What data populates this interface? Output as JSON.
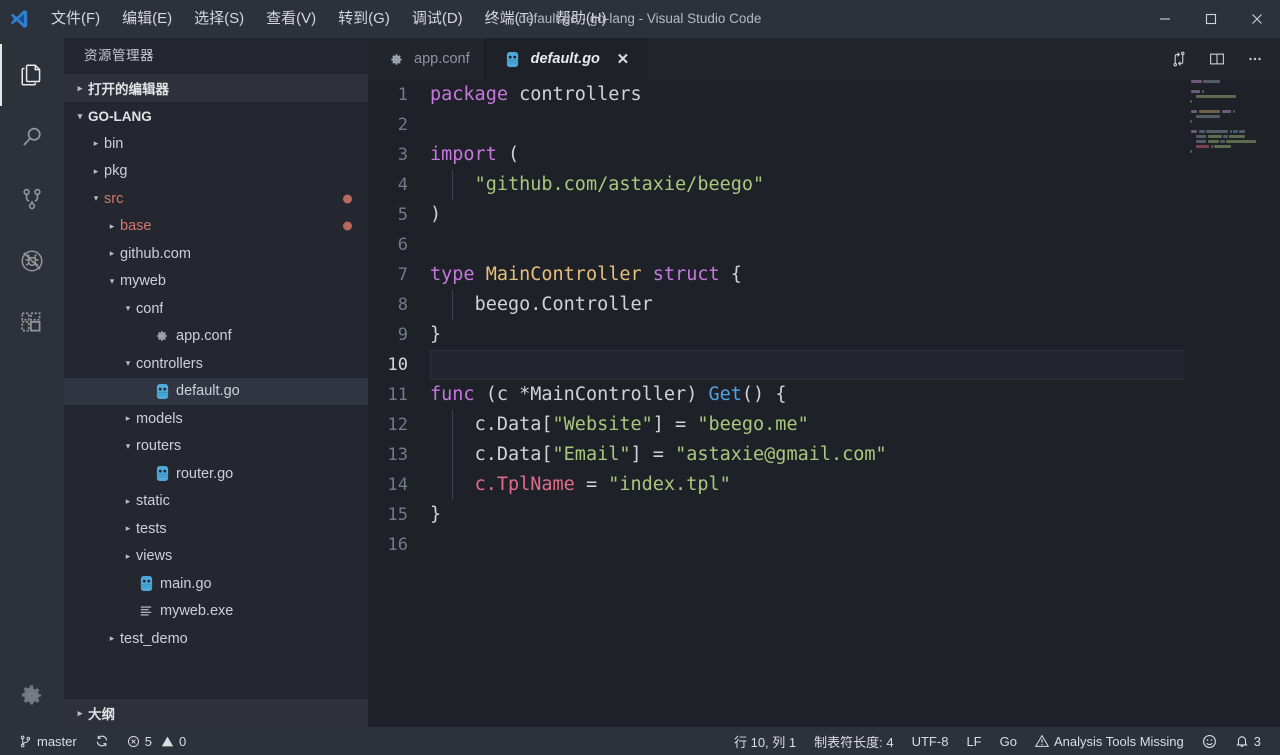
{
  "window": {
    "title": "default.go - go-lang - Visual Studio Code",
    "minimize_label": "─",
    "maximize_label": "☐",
    "close_label": "✕"
  },
  "menubar": {
    "items": [
      {
        "label": "文件(F)",
        "name": "menu-file"
      },
      {
        "label": "编辑(E)",
        "name": "menu-edit"
      },
      {
        "label": "选择(S)",
        "name": "menu-selection"
      },
      {
        "label": "查看(V)",
        "name": "menu-view"
      },
      {
        "label": "转到(G)",
        "name": "menu-go"
      },
      {
        "label": "调试(D)",
        "name": "menu-debug"
      },
      {
        "label": "终端(T)",
        "name": "menu-terminal"
      },
      {
        "label": "帮助(H)",
        "name": "menu-help"
      }
    ]
  },
  "activitybar": {
    "items": [
      {
        "icon": "files-icon",
        "name": "activity-explorer",
        "active": true
      },
      {
        "icon": "search-icon",
        "name": "activity-search",
        "active": false
      },
      {
        "icon": "source-control-icon",
        "name": "activity-source-control",
        "active": false
      },
      {
        "icon": "debug-icon",
        "name": "activity-debug",
        "active": false
      },
      {
        "icon": "extensions-icon",
        "name": "activity-extensions",
        "active": false
      }
    ],
    "settings": {
      "icon": "gear-icon",
      "name": "activity-settings"
    }
  },
  "sidebar": {
    "title": "资源管理器",
    "open_editors_label": "打开的编辑器",
    "project_label": "GO-LANG",
    "outline_label": "大纲",
    "tree": [
      {
        "label": "bin",
        "depth": 1,
        "type": "folder",
        "state": "collapsed",
        "modified": false,
        "dot": false,
        "selected": false
      },
      {
        "label": "pkg",
        "depth": 1,
        "type": "folder",
        "state": "collapsed",
        "modified": false,
        "dot": false,
        "selected": false
      },
      {
        "label": "src",
        "depth": 1,
        "type": "folder",
        "state": "expanded",
        "modified": true,
        "dot": true,
        "selected": false
      },
      {
        "label": "base",
        "depth": 2,
        "type": "folder",
        "state": "collapsed",
        "modified": true,
        "dot": true,
        "selected": false
      },
      {
        "label": "github.com",
        "depth": 2,
        "type": "folder",
        "state": "collapsed",
        "modified": false,
        "dot": false,
        "selected": false
      },
      {
        "label": "myweb",
        "depth": 2,
        "type": "folder",
        "state": "expanded",
        "modified": false,
        "dot": false,
        "selected": false
      },
      {
        "label": "conf",
        "depth": 3,
        "type": "folder",
        "state": "expanded",
        "modified": false,
        "dot": false,
        "selected": false
      },
      {
        "label": "app.conf",
        "depth": 4,
        "type": "conf",
        "state": "leaf",
        "modified": false,
        "dot": false,
        "selected": false
      },
      {
        "label": "controllers",
        "depth": 3,
        "type": "folder",
        "state": "expanded",
        "modified": false,
        "dot": false,
        "selected": false
      },
      {
        "label": "default.go",
        "depth": 4,
        "type": "go",
        "state": "leaf",
        "modified": false,
        "dot": false,
        "selected": true
      },
      {
        "label": "models",
        "depth": 3,
        "type": "folder",
        "state": "collapsed",
        "modified": false,
        "dot": false,
        "selected": false
      },
      {
        "label": "routers",
        "depth": 3,
        "type": "folder",
        "state": "expanded",
        "modified": false,
        "dot": false,
        "selected": false
      },
      {
        "label": "router.go",
        "depth": 4,
        "type": "go",
        "state": "leaf",
        "modified": false,
        "dot": false,
        "selected": false
      },
      {
        "label": "static",
        "depth": 3,
        "type": "folder",
        "state": "collapsed",
        "modified": false,
        "dot": false,
        "selected": false
      },
      {
        "label": "tests",
        "depth": 3,
        "type": "folder",
        "state": "collapsed",
        "modified": false,
        "dot": false,
        "selected": false
      },
      {
        "label": "views",
        "depth": 3,
        "type": "folder",
        "state": "collapsed",
        "modified": false,
        "dot": false,
        "selected": false
      },
      {
        "label": "main.go",
        "depth": 3,
        "type": "go",
        "state": "leaf",
        "modified": false,
        "dot": false,
        "selected": false
      },
      {
        "label": "myweb.exe",
        "depth": 3,
        "type": "exe",
        "state": "leaf",
        "modified": false,
        "dot": false,
        "selected": false
      },
      {
        "label": "test_demo",
        "depth": 2,
        "type": "folder",
        "state": "collapsed",
        "modified": false,
        "dot": false,
        "selected": false
      }
    ]
  },
  "tabs": [
    {
      "label": "app.conf",
      "icon": "conf-icon",
      "active": false,
      "closable": false,
      "name": "tab-app-conf"
    },
    {
      "label": "default.go",
      "icon": "go-icon",
      "active": true,
      "closable": true,
      "name": "tab-default-go"
    }
  ],
  "editor_actions": [
    {
      "icon": "split-compare-icon",
      "name": "open-changes-button"
    },
    {
      "icon": "split-editor-icon",
      "name": "split-editor-button"
    },
    {
      "icon": "more-actions-icon",
      "name": "more-actions-button"
    }
  ],
  "editor": {
    "filename": "default.go",
    "language": "Go",
    "current_line": 10,
    "lines": [
      {
        "n": 1,
        "tokens": [
          {
            "t": "package",
            "c": "k"
          },
          {
            "t": " ",
            "c": "p"
          },
          {
            "t": "controllers",
            "c": "p"
          }
        ]
      },
      {
        "n": 2,
        "tokens": []
      },
      {
        "n": 3,
        "tokens": [
          {
            "t": "import",
            "c": "k"
          },
          {
            "t": " (",
            "c": "p"
          }
        ]
      },
      {
        "n": 4,
        "tokens": [
          {
            "t": "    ",
            "c": "p"
          },
          {
            "t": "\"github.com/astaxie/beego\"",
            "c": "s"
          }
        ],
        "guide": 1
      },
      {
        "n": 5,
        "tokens": [
          {
            "t": ")",
            "c": "p"
          }
        ]
      },
      {
        "n": 6,
        "tokens": []
      },
      {
        "n": 7,
        "tokens": [
          {
            "t": "type",
            "c": "k"
          },
          {
            "t": " ",
            "c": "p"
          },
          {
            "t": "MainController",
            "c": "t"
          },
          {
            "t": " ",
            "c": "p"
          },
          {
            "t": "struct",
            "c": "k"
          },
          {
            "t": " {",
            "c": "p"
          }
        ]
      },
      {
        "n": 8,
        "tokens": [
          {
            "t": "    ",
            "c": "p"
          },
          {
            "t": "beego.Controller",
            "c": "p"
          }
        ],
        "guide": 1
      },
      {
        "n": 9,
        "tokens": [
          {
            "t": "}",
            "c": "p"
          }
        ]
      },
      {
        "n": 10,
        "tokens": []
      },
      {
        "n": 11,
        "tokens": [
          {
            "t": "func",
            "c": "k"
          },
          {
            "t": " (c *",
            "c": "p"
          },
          {
            "t": "MainController",
            "c": "p"
          },
          {
            "t": ") ",
            "c": "p"
          },
          {
            "t": "Get",
            "c": "fn"
          },
          {
            "t": "() {",
            "c": "p"
          }
        ]
      },
      {
        "n": 12,
        "tokens": [
          {
            "t": "    ",
            "c": "p"
          },
          {
            "t": "c.Data[",
            "c": "p"
          },
          {
            "t": "\"Website\"",
            "c": "s"
          },
          {
            "t": "] = ",
            "c": "p"
          },
          {
            "t": "\"beego.me\"",
            "c": "s"
          }
        ],
        "guide": 1
      },
      {
        "n": 13,
        "tokens": [
          {
            "t": "    ",
            "c": "p"
          },
          {
            "t": "c.Data[",
            "c": "p"
          },
          {
            "t": "\"Email\"",
            "c": "s"
          },
          {
            "t": "] = ",
            "c": "p"
          },
          {
            "t": "\"astaxie@gmail.com\"",
            "c": "s"
          }
        ],
        "guide": 1
      },
      {
        "n": 14,
        "tokens": [
          {
            "t": "    ",
            "c": "p"
          },
          {
            "t": "c.TplName",
            "c": "pr"
          },
          {
            "t": " = ",
            "c": "p"
          },
          {
            "t": "\"index.tpl\"",
            "c": "s"
          }
        ],
        "guide": 1
      },
      {
        "n": 15,
        "tokens": [
          {
            "t": "}",
            "c": "p"
          }
        ]
      },
      {
        "n": 16,
        "tokens": []
      }
    ]
  },
  "statusbar": {
    "left": [
      {
        "icon": "git-branch-icon",
        "label": "master",
        "name": "status-branch"
      },
      {
        "icon": "sync-icon",
        "label": "",
        "name": "status-sync"
      },
      {
        "icon": "error-icon",
        "label": "5",
        "name": "status-errors",
        "extra_icon": "warning-icon",
        "extra_label": "0"
      }
    ],
    "right": [
      {
        "icon": "",
        "label": "行 10, 列 1",
        "name": "status-cursor-position"
      },
      {
        "icon": "",
        "label": "制表符长度: 4",
        "name": "status-indentation"
      },
      {
        "icon": "",
        "label": "UTF-8",
        "name": "status-encoding"
      },
      {
        "icon": "",
        "label": "LF",
        "name": "status-eol"
      },
      {
        "icon": "",
        "label": "Go",
        "name": "status-language-mode"
      },
      {
        "icon": "warning-icon",
        "label": "Analysis Tools Missing",
        "name": "status-analysis-tools"
      },
      {
        "icon": "smiley-icon",
        "label": "",
        "name": "status-feedback"
      },
      {
        "icon": "bell-icon",
        "label": "3",
        "name": "status-notifications"
      }
    ]
  },
  "colors": {
    "titlebar_bg": "#2d313a",
    "sidebar_bg": "#252730",
    "editor_bg": "#1e2128",
    "statusbar_bg": "#2d313a",
    "accent_blue": "#4fa3e3",
    "modified_red": "#d4766b",
    "string_green": "#a9c77d",
    "keyword_purple": "#c678dd",
    "type_yellow": "#e5c07b"
  }
}
